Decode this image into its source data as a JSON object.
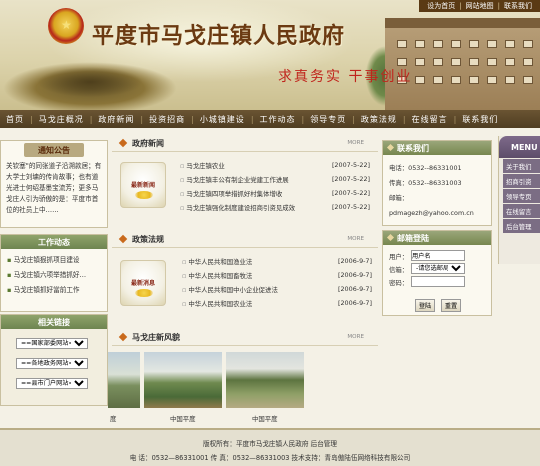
{
  "header": {
    "site_title": "平度市马戈庄镇人民政府",
    "slogan": "求真务实  干事创业",
    "toplinks": [
      "设为首页",
      "网站地图",
      "联系我们"
    ]
  },
  "nav": [
    "首页",
    "马戈庄概况",
    "政府新闻",
    "投资招商",
    "小城镇建设",
    "工作动态",
    "领导专页",
    "政策法规",
    "在线留言",
    "联系我们"
  ],
  "notice": {
    "title": "通知公告",
    "text": "关钦塞\"的同张道子沿溯款居；有大学士刘墉的传肯故事；也有道光进士何绍基墨宝流芳；更多马戈庄人引为骄傲的是：平度市首位的社员上中……"
  },
  "work": {
    "title": "工作动态",
    "items": [
      "马戈庄镇狠抓项目建设",
      "马戈庄镇六项举措抓好…",
      "马戈庄镇抓好當前工作"
    ]
  },
  "links": {
    "title": "相关链接",
    "selects": [
      "==国家部委网站==",
      "==各地政务网站==",
      "==县市门户网站=="
    ]
  },
  "gov_news": {
    "title": "政府新闻",
    "more": "MORE",
    "thumb_label": "最新新闻",
    "items": [
      {
        "title": "马戈庄镇农业",
        "date": "[2007-5-22]"
      },
      {
        "title": "马戈庄镇丰公有制企业党建工作进展",
        "date": "[2007-5-22]"
      },
      {
        "title": "马戈庄镇四项举措抓好村集体增收",
        "date": "[2007-5-22]"
      },
      {
        "title": "马戈庄镇强化制度建设招商引资见成效",
        "date": "[2007-5-22]"
      }
    ]
  },
  "policy": {
    "title": "政策法规",
    "more": "MORE",
    "thumb_label": "最新消息",
    "items": [
      {
        "title": "中华人民共和国渔业法",
        "date": "[2006-9-7]"
      },
      {
        "title": "中华人民共和国畜牧法",
        "date": "[2006-9-7]"
      },
      {
        "title": "中华人民共和国中小企业促进法",
        "date": "[2006-9-7]"
      },
      {
        "title": "中华人民共和国农业法",
        "date": "[2006-9-7]"
      }
    ]
  },
  "scenery": {
    "title": "马戈庄新风貌",
    "more": "MORE",
    "captions": [
      "度",
      "中国平度",
      "中国平度"
    ]
  },
  "contact": {
    "title": "联系我们",
    "phone": "电话：0532--86331001",
    "fax": "传真：0532--86331003",
    "email_label": "邮箱：",
    "email": "pdmagezh@yahoo.com.cn"
  },
  "mail_login": {
    "title": "邮箱登陆",
    "user_label": "用户：",
    "user_value": "用户名",
    "box_label": "信箱：",
    "box_option": "-请您选邮局-",
    "pwd_label": "密码：",
    "login_btn": "登陆",
    "reset_btn": "重置"
  },
  "side_menu": {
    "title": "MENU",
    "items": [
      "关于我们",
      "招商引资",
      "领导专页",
      "在线留言",
      "后台管理"
    ]
  },
  "footer": {
    "line1": "版权所有：平度市马戈庄镇人民政府   后台管理",
    "line2": "电  话：0532—86331001     传  真：0532—86331003   技术支持：青岛傲陆伍网络科技有限公司"
  }
}
